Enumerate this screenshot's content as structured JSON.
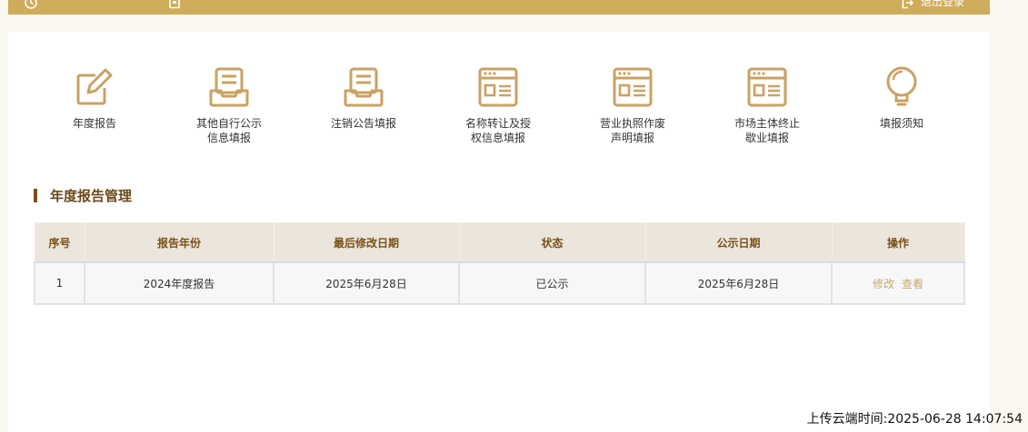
{
  "topbar": {
    "logout_label": "退出登录"
  },
  "tiles": [
    {
      "icon": "edit-icon",
      "label_line1": "年度报告",
      "label_line2": ""
    },
    {
      "icon": "tray-document-icon",
      "label_line1": "其他自行公示",
      "label_line2": "信息填报"
    },
    {
      "icon": "tray-document-icon",
      "label_line1": "注销公告填报",
      "label_line2": ""
    },
    {
      "icon": "browser-form-icon",
      "label_line1": "名称转让及授",
      "label_line2": "权信息填报"
    },
    {
      "icon": "browser-form-icon",
      "label_line1": "营业执照作废",
      "label_line2": "声明填报"
    },
    {
      "icon": "browser-form-icon",
      "label_line1": "市场主体终止",
      "label_line2": "歇业填报"
    },
    {
      "icon": "lightbulb-icon",
      "label_line1": "填报须知",
      "label_line2": ""
    }
  ],
  "section": {
    "title": "年度报告管理"
  },
  "table": {
    "headers": [
      "序号",
      "报告年份",
      "最后修改日期",
      "状态",
      "公示日期",
      "操作"
    ],
    "rows": [
      {
        "index": "1",
        "report_year": "2024年度报告",
        "last_modified": "2025年6月28日",
        "status": "已公示",
        "publish_date": "2025年6月28日",
        "op_edit": "修改",
        "op_view": "查看"
      }
    ]
  },
  "footer": {
    "upload_time": "上传云端时间:2025-06-28 14:07:54"
  },
  "colors": {
    "accent": "#cfab5c",
    "icon": "#c9a263",
    "title": "#6b4a1a"
  }
}
